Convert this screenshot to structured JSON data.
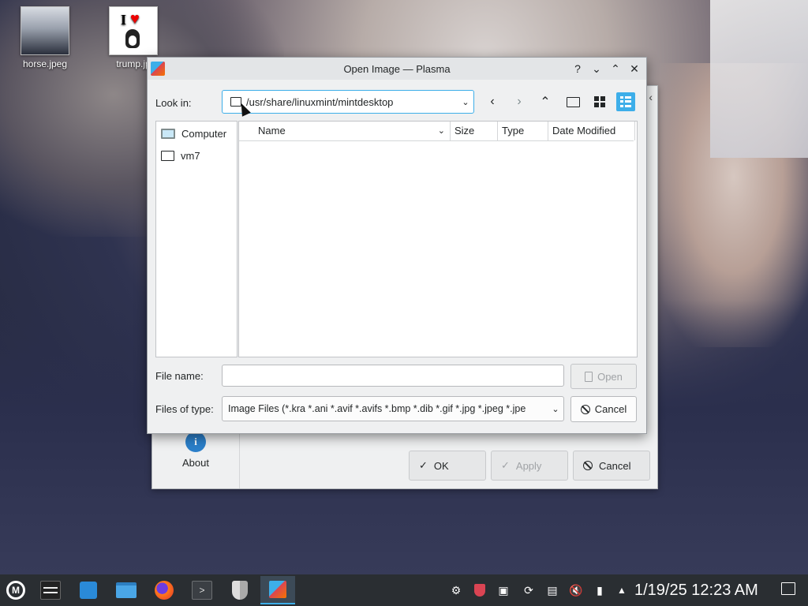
{
  "desktop": {
    "icons": [
      {
        "label": "horse.jpeg"
      },
      {
        "label": "trump.jp"
      }
    ],
    "thumb_text": {
      "I": "I"
    }
  },
  "background_window": {
    "about_label": "About",
    "ok_label": "OK",
    "apply_label": "Apply",
    "cancel_label": "Cancel"
  },
  "dialog": {
    "title": "Open Image — Plasma",
    "titlebar_buttons": {
      "help": "?",
      "minimize": "⌄",
      "maximize": "⌃",
      "close": "✕"
    },
    "look_in_label": "Look in:",
    "path": "/usr/share/linuxmint/mintdesktop",
    "places": [
      {
        "label": "Computer",
        "icon": "monitor-icon"
      },
      {
        "label": "vm7",
        "icon": "folder-icon"
      }
    ],
    "columns": {
      "name": "Name",
      "size": "Size",
      "type": "Type",
      "date": "Date Modified"
    },
    "file_name_label": "File name:",
    "file_name_value": "",
    "open_label": "Open",
    "files_of_type_label": "Files of type:",
    "files_of_type_value": "Image Files (*.kra *.ani *.avif *.avifs *.bmp *.dib *.gif *.jpg *.jpeg *.jpe",
    "cancel_label": "Cancel"
  },
  "taskbar": {
    "clock": "1/19/25 12:23 AM",
    "menu_glyph": "M",
    "terminal_glyph": ">"
  },
  "colors": {
    "accent": "#3daee9",
    "taskbar_bg": "#2a2e32",
    "dialog_bg": "#eff0f1"
  }
}
